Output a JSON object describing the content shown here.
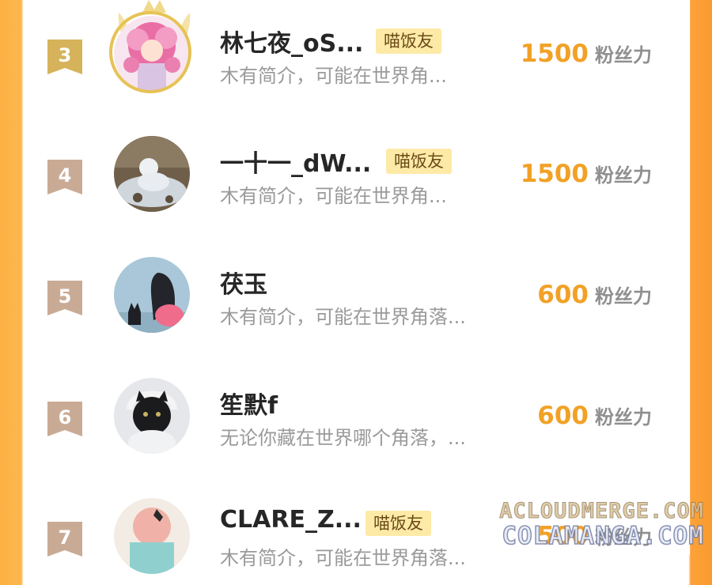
{
  "rows": [
    {
      "rank": "3",
      "name": "林七夜_oS...",
      "badge": "喵饭友",
      "bio": "木有简介，可能在世界角...",
      "score": "1500",
      "unit": "粉丝力"
    },
    {
      "rank": "4",
      "name": "一十一_dW...",
      "badge": "喵饭友",
      "bio": "木有简介，可能在世界角...",
      "score": "1500",
      "unit": "粉丝力"
    },
    {
      "rank": "5",
      "name": "茯玉",
      "badge": "",
      "bio": "木有简介，可能在世界角落...",
      "score": "600",
      "unit": "粉丝力"
    },
    {
      "rank": "6",
      "name": "笙默f",
      "badge": "",
      "bio": "无论你藏在世界哪个角落，...",
      "score": "600",
      "unit": "粉丝力"
    },
    {
      "rank": "7",
      "name": "CLARE_Z...",
      "badge": "喵饭友",
      "bio": "木有简介，可能在世界角落...",
      "score": "500",
      "unit": "粉丝力"
    }
  ],
  "watermark": {
    "line1": "ACLOUDMERGE.COM",
    "line2": "COLAMANGA.COM"
  },
  "colors": {
    "rank_top3": "#d6b35a",
    "rank_other": "#c9ab95",
    "score": "#f2a126",
    "badge_bg": "#fdeaa7"
  }
}
